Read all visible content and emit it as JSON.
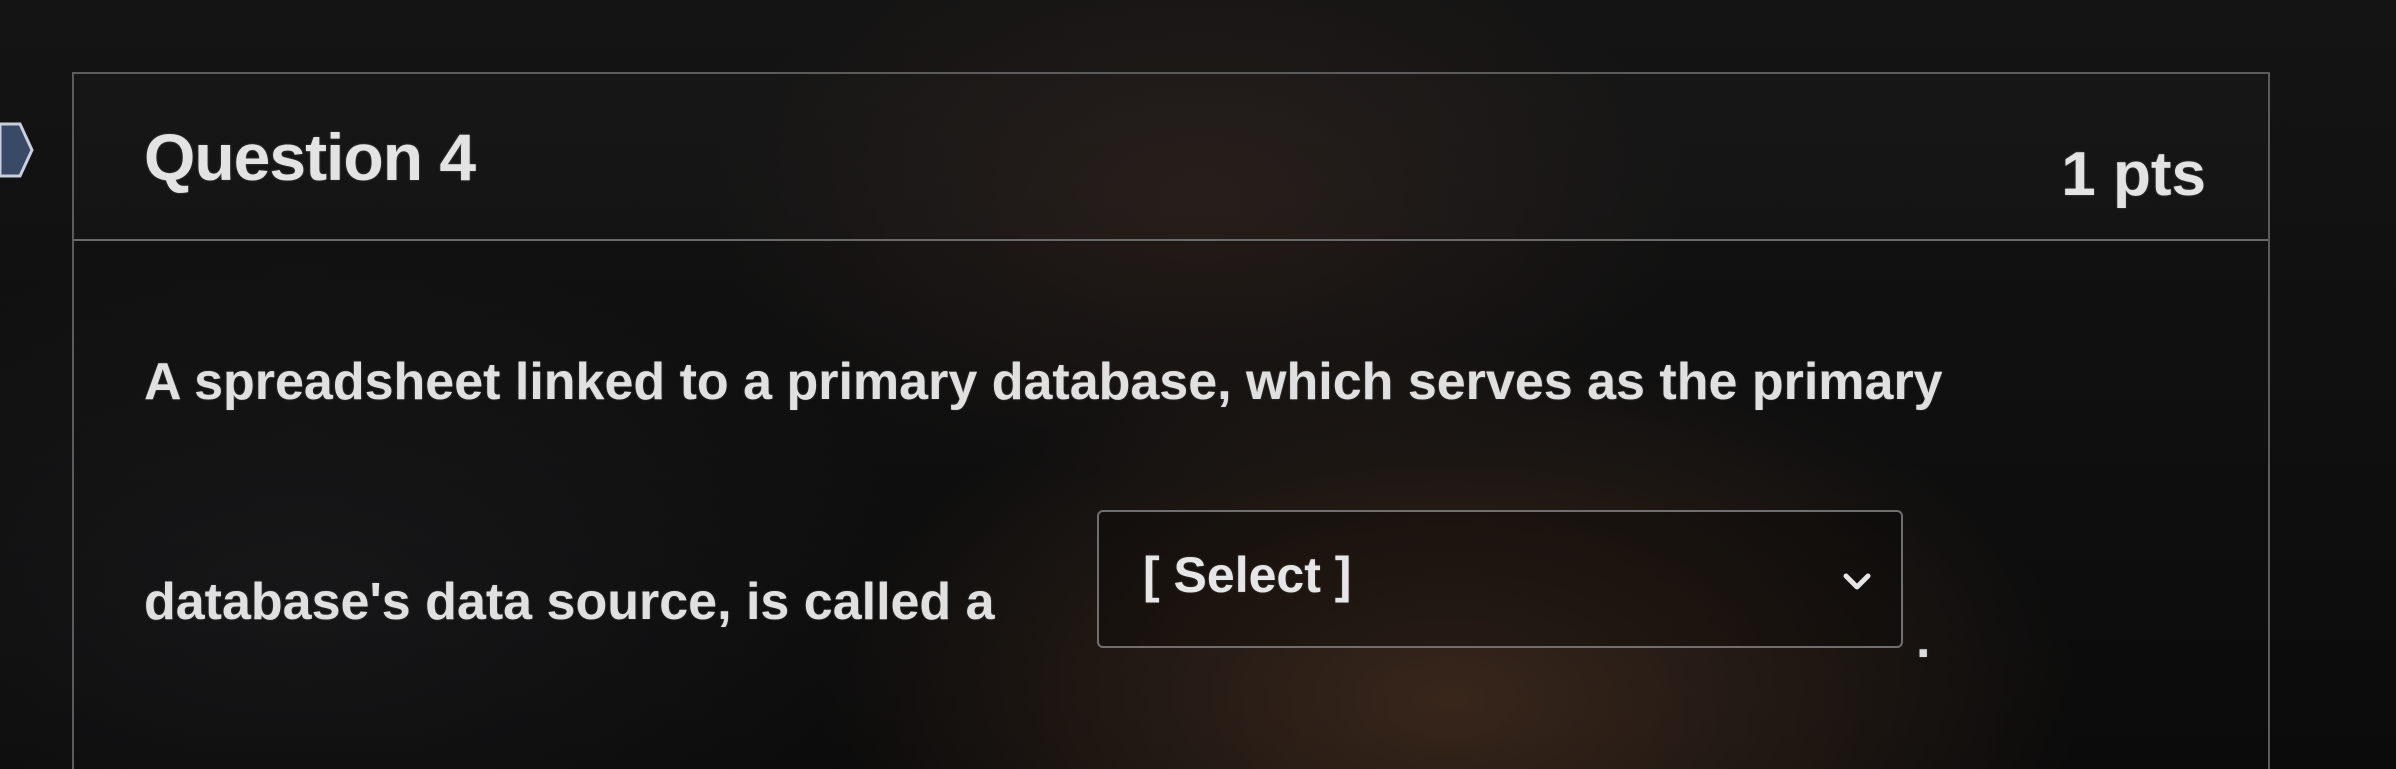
{
  "question": {
    "title": "Question 4",
    "points": "1 pts",
    "text_line1": "A spreadsheet linked to a primary database, which serves as the primary",
    "text_line2": "database's data source, is called a",
    "trailing_punctuation": "."
  },
  "answer_select": {
    "selected_value": "[ Select ]"
  },
  "icons": {
    "dropdown": "chevron-down-icon",
    "left_marker": "bookmark-flag-icon"
  },
  "colors": {
    "background": "#0c0c0c",
    "card_border": "#5b5b5b",
    "text": "#e3e3e3"
  }
}
